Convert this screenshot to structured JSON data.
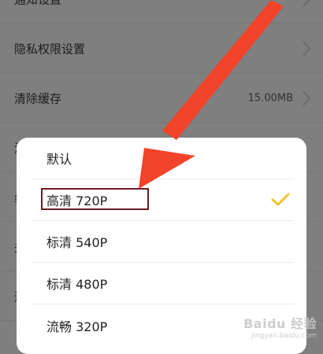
{
  "settings": {
    "rows": [
      {
        "label": "通知设置"
      },
      {
        "label": "隐私权限设置"
      },
      {
        "label": "清除缓存",
        "value": "15.00MB"
      },
      {
        "label": "清"
      },
      {
        "label": "纟"
      },
      {
        "label": "关"
      },
      {
        "label": "退"
      }
    ]
  },
  "dialog": {
    "options": [
      {
        "label": "默认",
        "selected": false
      },
      {
        "label": "高清 720P",
        "selected": true
      },
      {
        "label": "标清 540P",
        "selected": false
      },
      {
        "label": "标清 480P",
        "selected": false
      },
      {
        "label": "流畅 320P",
        "selected": false
      }
    ]
  },
  "colors": {
    "check": "#f2c230",
    "arrow": "#f1442a",
    "highlight_box": "#6b1b20"
  },
  "watermark": {
    "main": "Baidu 经验",
    "sub": "jingyan.baidu.com"
  }
}
